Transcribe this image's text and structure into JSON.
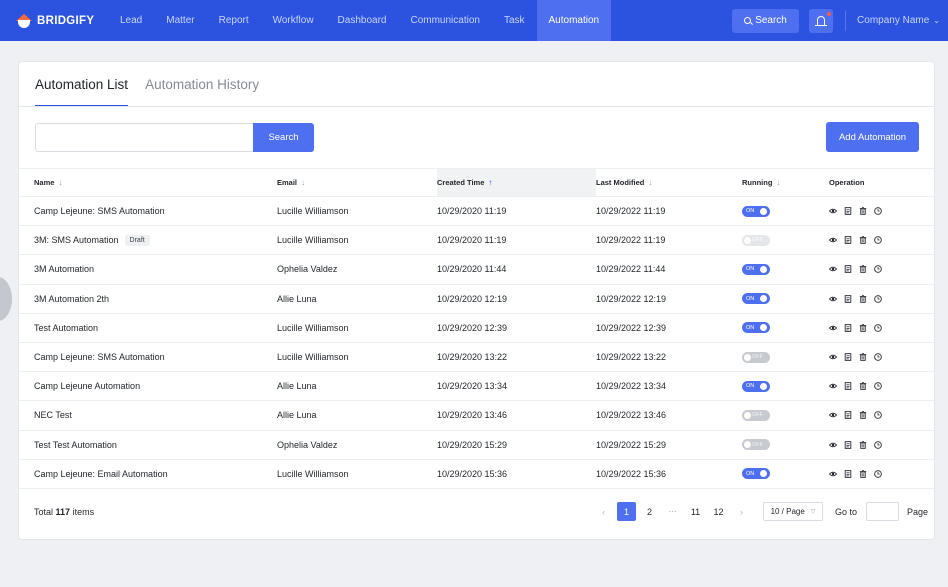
{
  "brand": {
    "name": "BRIDGIFY"
  },
  "nav": {
    "items": [
      {
        "label": "Lead",
        "active": false
      },
      {
        "label": "Matter",
        "active": false
      },
      {
        "label": "Report",
        "active": false
      },
      {
        "label": "Workflow",
        "active": false
      },
      {
        "label": "Dashboard",
        "active": false
      },
      {
        "label": "Communication",
        "active": false
      },
      {
        "label": "Task",
        "active": false
      },
      {
        "label": "Automation",
        "active": true
      }
    ],
    "search_label": "Search",
    "company_label": "Company Name"
  },
  "tabs": [
    {
      "label": "Automation List",
      "active": true
    },
    {
      "label": "Automation History",
      "active": false
    }
  ],
  "toolbar": {
    "search_value": "",
    "search_button": "Search",
    "add_button": "Add Automation"
  },
  "table": {
    "headers": {
      "name": "Name",
      "email": "Email",
      "created": "Created Time",
      "modified": "Last Modified",
      "running": "Running",
      "operation": "Operation"
    },
    "rows": [
      {
        "name": "Camp Lejeune: SMS Automation",
        "badge": "",
        "email": "Lucille Williamson",
        "created": "10/29/2020 11:19",
        "modified": "10/29/2022 11:19",
        "running": "ON",
        "disabled": false
      },
      {
        "name": "3M: SMS Automation",
        "badge": "Draft",
        "email": "Lucille Williamson",
        "created": "10/29/2020 11:19",
        "modified": "10/29/2022 11:19",
        "running": "OFF",
        "disabled": true
      },
      {
        "name": "3M Automation",
        "badge": "",
        "email": "Ophelia Valdez",
        "created": "10/29/2020 11:44",
        "modified": "10/29/2022 11:44",
        "running": "ON",
        "disabled": false
      },
      {
        "name": "3M Automation 2th",
        "badge": "",
        "email": "Allie Luna",
        "created": "10/29/2020 12:19",
        "modified": "10/29/2022 12:19",
        "running": "ON",
        "disabled": false
      },
      {
        "name": "Test Automation",
        "badge": "",
        "email": "Lucille Williamson",
        "created": "10/29/2020 12:39",
        "modified": "10/29/2022 12:39",
        "running": "ON",
        "disabled": false
      },
      {
        "name": "Camp Lejeune: SMS Automation",
        "badge": "",
        "email": "Lucille Williamson",
        "created": "10/29/2020 13:22",
        "modified": "10/29/2022 13:22",
        "running": "OFF",
        "disabled": false
      },
      {
        "name": "Camp Lejeune Automation",
        "badge": "",
        "email": "Allie Luna",
        "created": "10/29/2020 13:34",
        "modified": "10/29/2022 13:34",
        "running": "ON",
        "disabled": false
      },
      {
        "name": "NEC Test",
        "badge": "",
        "email": "Allie Luna",
        "created": "10/29/2020 13:46",
        "modified": "10/29/2022 13:46",
        "running": "OFF",
        "disabled": false
      },
      {
        "name": "Test Test Automation",
        "badge": "",
        "email": "Ophelia Valdez",
        "created": "10/29/2020 15:29",
        "modified": "10/29/2022 15:29",
        "running": "OFF",
        "disabled": false
      },
      {
        "name": "Camp Lejeune: Email Automation",
        "badge": "",
        "email": "Lucille Williamson",
        "created": "10/29/2020 15:36",
        "modified": "10/29/2022 15:36",
        "running": "ON",
        "disabled": false
      }
    ],
    "operation_icons": [
      "eye-icon",
      "document-icon",
      "trash-icon",
      "clock-icon"
    ]
  },
  "pagination": {
    "total_prefix": "Total",
    "total_count": "117",
    "total_suffix": "items",
    "prev": "‹",
    "next": "›",
    "pages": [
      "1",
      "2",
      "···",
      "11",
      "12"
    ],
    "current": "1",
    "per_page": "10 / Page",
    "goto_label": "Go to",
    "goto_value": "",
    "page_label": "Page"
  },
  "colors": {
    "nav_bg": "#2b53e0",
    "accent": "#4d6ff0",
    "toggle_off": "#c7cad0"
  }
}
